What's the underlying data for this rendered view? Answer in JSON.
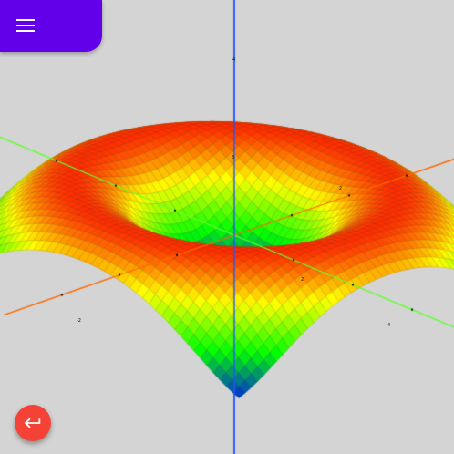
{
  "app": {
    "menu_icon": "menu-icon",
    "back_icon": "return-arrow-icon"
  },
  "plot": {
    "type": "surface-3d",
    "function_shape": "radial ripple surface z = f(sqrt(x^2 + y^2))",
    "colormap": [
      "#0000ff",
      "#00ff00",
      "#ffff00",
      "#ff0000"
    ],
    "axis_colors": {
      "x": "#ff6a00",
      "y": "#66ff33",
      "z": "#2255ff"
    },
    "tick_labels": [
      "4",
      "3",
      "2",
      "-2",
      "-4",
      "-2",
      "0",
      "-4",
      "2",
      "4"
    ]
  },
  "colors": {
    "background": "#d4d4d4",
    "menu_bar": "#6200ea",
    "fab": "#f44336"
  }
}
